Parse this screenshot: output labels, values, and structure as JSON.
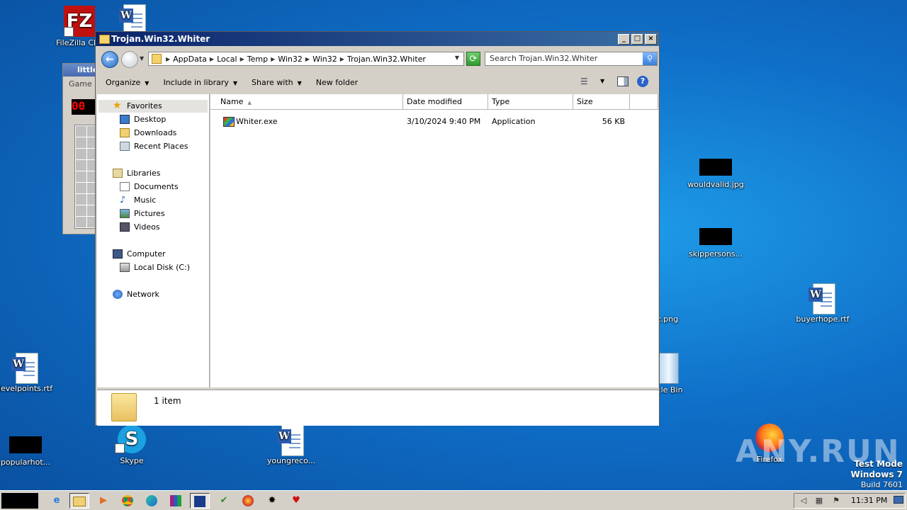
{
  "desktop": {
    "icons": [
      {
        "name": "FileZilla Client",
        "label": "FileZilla Clie"
      },
      {
        "label": "wouldvalid.jpg"
      },
      {
        "label": "skippersons..."
      },
      {
        "label": "z.png"
      },
      {
        "label": "buyerhope.rtf"
      },
      {
        "label": "levelpoints.rtf"
      },
      {
        "label": "cle Bin"
      },
      {
        "label": "popularhot..."
      },
      {
        "label": "Skype"
      },
      {
        "label": "youngreco..."
      },
      {
        "label": "Firefox"
      }
    ]
  },
  "minesweeper": {
    "title": "little",
    "menu": "Game",
    "counter": "00"
  },
  "explorer": {
    "title": "Trojan.Win32.Whiter",
    "breadcrumbs": [
      "AppData",
      "Local",
      "Temp",
      "Win32",
      "Win32",
      "Trojan.Win32.Whiter"
    ],
    "search_placeholder": "Search Trojan.Win32.Whiter",
    "commands": {
      "organize": "Organize",
      "include_in_library": "Include in library",
      "share_with": "Share with",
      "new_folder": "New folder"
    },
    "nav": {
      "favorites": "Favorites",
      "desktop": "Desktop",
      "downloads": "Downloads",
      "recent_places": "Recent Places",
      "libraries": "Libraries",
      "documents": "Documents",
      "music": "Music",
      "pictures": "Pictures",
      "videos": "Videos",
      "computer": "Computer",
      "local_disk": "Local Disk (C:)",
      "network": "Network"
    },
    "columns": {
      "name": "Name",
      "date_modified": "Date modified",
      "type": "Type",
      "size": "Size"
    },
    "files": [
      {
        "name": "Whiter.exe",
        "date_modified": "3/10/2024 9:40 PM",
        "type": "Application",
        "size": "56 KB"
      }
    ],
    "status": "1 item"
  },
  "watermark": {
    "brand": "ANY.RUN",
    "line1": "Test Mode",
    "line2": "Windows 7",
    "line3": "Build 7601"
  },
  "taskbar": {
    "clock": "11:31 PM"
  }
}
